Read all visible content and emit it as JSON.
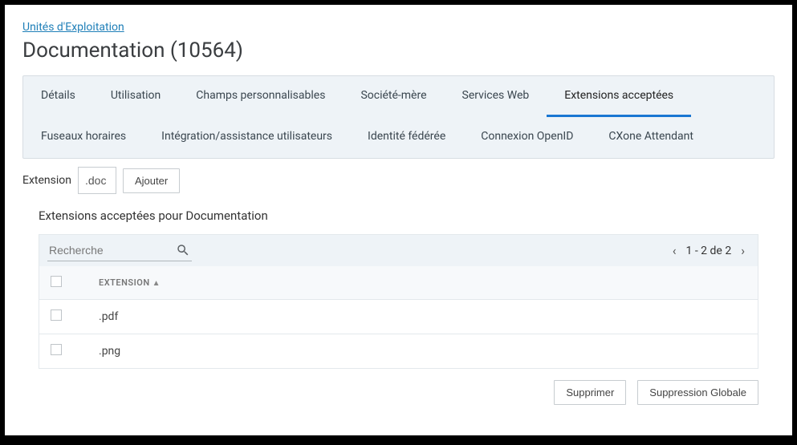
{
  "breadcrumb": "Unités d'Exploitation",
  "page_title": "Documentation (10564)",
  "tabs": {
    "row1": [
      {
        "label": "Détails",
        "active": false
      },
      {
        "label": "Utilisation",
        "active": false
      },
      {
        "label": "Champs personnalisables",
        "active": false
      },
      {
        "label": "Société-mère",
        "active": false
      },
      {
        "label": "Services Web",
        "active": false
      },
      {
        "label": "Extensions acceptées",
        "active": true
      }
    ],
    "row2": [
      {
        "label": "Fuseaux horaires",
        "active": false
      },
      {
        "label": "Intégration/assistance utilisateurs",
        "active": false
      },
      {
        "label": "Identité fédérée",
        "active": false
      },
      {
        "label": "Connexion OpenID",
        "active": false
      },
      {
        "label": "CXone Attendant",
        "active": false
      }
    ]
  },
  "ext_add": {
    "label": "Extension",
    "value": ".doc",
    "button": "Ajouter"
  },
  "section_title": "Extensions acceptées pour Documentation",
  "table": {
    "search_placeholder": "Recherche",
    "pagination": "1 - 2 de 2",
    "column_header": "EXTENSION",
    "rows": [
      {
        "ext": ".pdf"
      },
      {
        "ext": ".png"
      }
    ],
    "delete_btn": "Supprimer",
    "global_delete_btn": "Suppression Globale"
  }
}
